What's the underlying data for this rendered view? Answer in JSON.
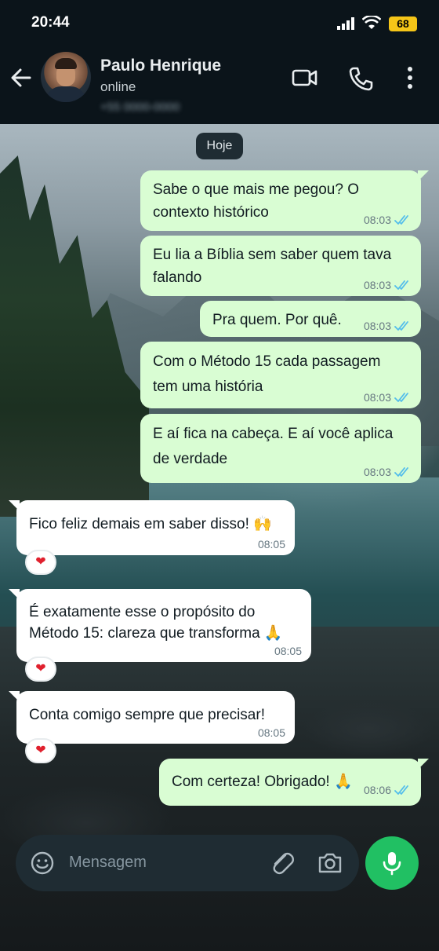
{
  "status_bar": {
    "time": "20:44",
    "battery": "68"
  },
  "header": {
    "contact_name": "Paulo Henrique",
    "status": "online",
    "phone": "+55 0000-0000"
  },
  "date_chip": "Hoje",
  "messages": [
    {
      "dir": "out",
      "text": "Sabe o que mais me pegou? O contexto histórico",
      "time": "08:03",
      "read": true
    },
    {
      "dir": "out",
      "text": "Eu lia a Bíblia sem saber quem tava falando",
      "time": "08:03",
      "read": true
    },
    {
      "dir": "out",
      "text": "Pra quem. Por quê.",
      "time": "08:03",
      "read": true
    },
    {
      "dir": "out",
      "text": "Com o Método 15 cada passagem tem uma história",
      "time": "08:03",
      "read": true
    },
    {
      "dir": "out",
      "text": "E aí fica na cabeça. E aí você aplica de verdade",
      "time": "08:03",
      "read": true
    },
    {
      "dir": "in",
      "text": "Fico feliz demais em saber disso! 🙌",
      "time": "08:05",
      "reaction": "❤"
    },
    {
      "dir": "in",
      "text": "É exatamente esse o propósito do Método 15: clareza que transforma 🙏",
      "time": "08:05",
      "reaction": "❤"
    },
    {
      "dir": "in",
      "text": "Conta comigo sempre que precisar!",
      "time": "08:05",
      "reaction": "❤"
    },
    {
      "dir": "out",
      "text": "Com certeza! Obrigado! 🙏",
      "time": "08:06",
      "read": true
    }
  ],
  "input": {
    "placeholder": "Mensagem"
  },
  "colors": {
    "outgoing_bubble": "#d9fdd3",
    "incoming_bubble": "#ffffff",
    "read_ticks": "#53bdeb",
    "mic_button": "#21c063",
    "header_bg": "#0b141a"
  },
  "icons": [
    "back-arrow-icon",
    "video-call-icon",
    "voice-call-icon",
    "more-options-icon",
    "emoji-icon",
    "attach-icon",
    "camera-icon",
    "mic-icon"
  ]
}
